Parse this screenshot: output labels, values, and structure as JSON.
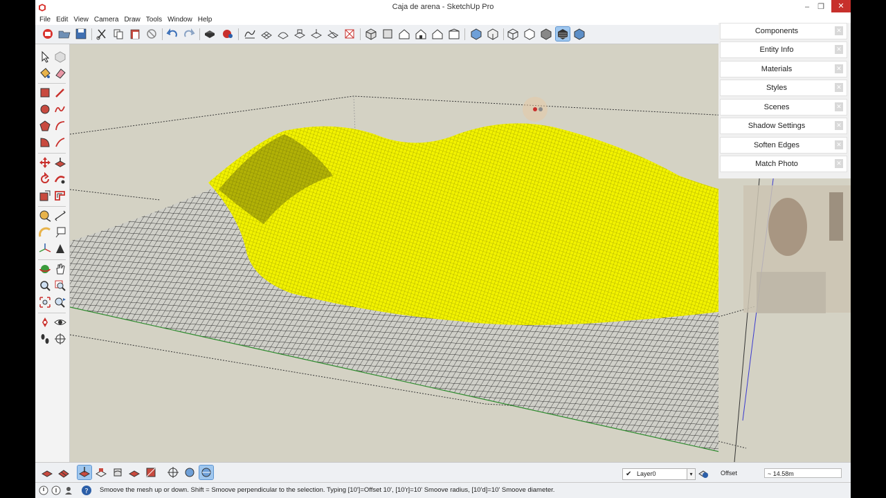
{
  "window": {
    "title": "Caja de arena - SketchUp Pro"
  },
  "menu": {
    "items": [
      "File",
      "Edit",
      "View",
      "Camera",
      "Draw",
      "Tools",
      "Window",
      "Help"
    ]
  },
  "trays": [
    {
      "label": "Components"
    },
    {
      "label": "Entity Info"
    },
    {
      "label": "Materials"
    },
    {
      "label": "Styles"
    },
    {
      "label": "Scenes"
    },
    {
      "label": "Shadow Settings"
    },
    {
      "label": "Soften Edges"
    },
    {
      "label": "Match Photo"
    }
  ],
  "layer": {
    "name": "Layer0"
  },
  "vcb": {
    "label": "Offset",
    "value": "~ 14.58m"
  },
  "status": {
    "text": "Smoove the mesh up or down.  Shift = Smoove perpendicular to the selection.  Typing [10']=Offset 10', [10'r]=10' Smoove radius, [10'd]=10' Smoove diameter."
  },
  "colors": {
    "selection_yellow": "#f2f200",
    "sky": "#d4d2c4",
    "active_tool": "#9fc7ef",
    "close_red": "#c7302c"
  }
}
